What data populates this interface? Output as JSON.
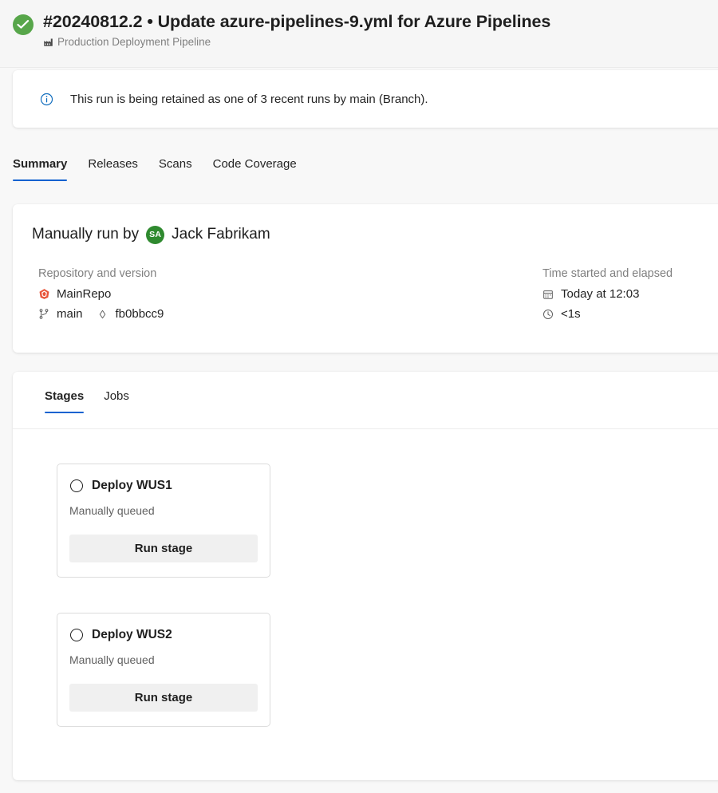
{
  "header": {
    "status_icon": "check-circle-icon",
    "status_color": "#57a64a",
    "run_title": "#20240812.2 • Update azure-pipelines-9.yml for Azure Pipelines",
    "pipeline_icon": "factory-icon",
    "pipeline_name": "Production Deployment Pipeline"
  },
  "banner": {
    "icon": "info-circle-icon",
    "icon_color": "#0f6cbd",
    "message": "This run is being retained as one of 3 recent runs by main (Branch)."
  },
  "main_tabs": [
    {
      "label": "Summary",
      "active": true
    },
    {
      "label": "Releases",
      "active": false
    },
    {
      "label": "Scans",
      "active": false
    },
    {
      "label": "Code Coverage",
      "active": false
    }
  ],
  "summary": {
    "run_by_prefix": "Manually run by",
    "avatar_initials": "SA",
    "avatar_color": "#2f8a2f",
    "user_name": "Jack Fabrikam",
    "repository": {
      "label": "Repository and version",
      "repo_icon": "azure-repos-icon",
      "repo_name": "MainRepo",
      "branch_icon": "branch-icon",
      "branch_name": "main",
      "commit_icon": "commit-icon",
      "commit_hash": "fb0bbcc9"
    },
    "time": {
      "label": "Time started and elapsed",
      "calendar_icon": "calendar-icon",
      "started": "Today at 12:03",
      "clock_icon": "clock-icon",
      "elapsed": "<1s"
    }
  },
  "stages_section": {
    "tabs": [
      {
        "label": "Stages",
        "active": true
      },
      {
        "label": "Jobs",
        "active": false
      }
    ],
    "stages": [
      {
        "status_icon": "circle-outline-icon",
        "name": "Deploy WUS1",
        "status_text": "Manually queued",
        "action_label": "Run stage"
      },
      {
        "status_icon": "circle-outline-icon",
        "name": "Deploy WUS2",
        "status_text": "Manually queued",
        "action_label": "Run stage"
      }
    ]
  },
  "accent_color": "#0f62d0"
}
